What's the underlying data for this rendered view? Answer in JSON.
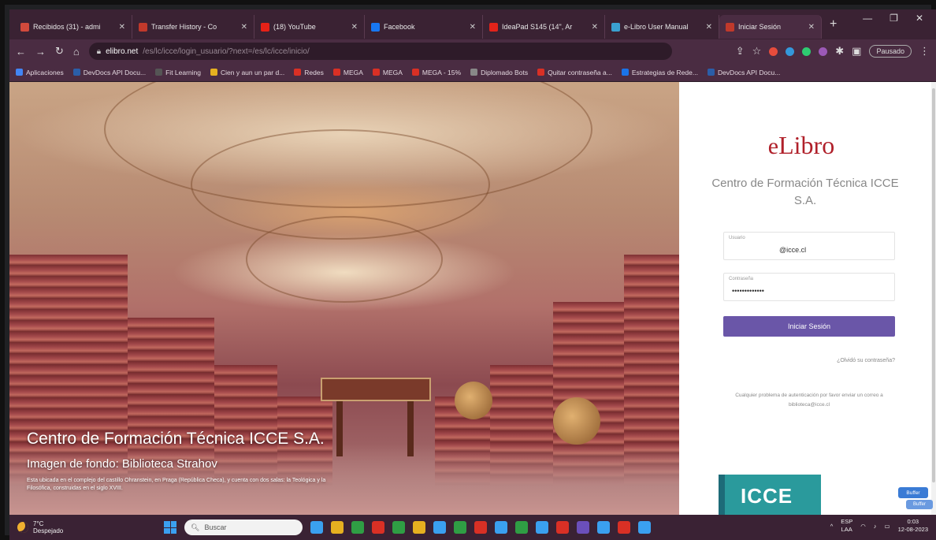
{
  "browser": {
    "tabs": [
      {
        "title": "Recibidos (31) - admi",
        "color": "#d24a3c"
      },
      {
        "title": "Transfer History - Co",
        "color": "#c0392b"
      },
      {
        "title": "(18) YouTube",
        "color": "#e62117"
      },
      {
        "title": "Facebook",
        "color": "#1877f2"
      },
      {
        "title": "IdeaPad S145 (14\", Ar",
        "color": "#e2231a"
      },
      {
        "title": "e-Libro User Manual",
        "color": "#3aa0d0"
      },
      {
        "title": "Iniciar Sesión",
        "color": "#c0392b",
        "active": true
      }
    ],
    "url_host": "elibro.net",
    "url_path": "/es/lc/icce/login_usuario/?next=/es/lc/icce/inicio/",
    "profile_label": "Pausado",
    "bookmarks": [
      {
        "label": "Aplicaciones",
        "color": "#4285f4"
      },
      {
        "label": "DevDocs API Docu...",
        "color": "#2b5ea8"
      },
      {
        "label": "Fit Learning",
        "color": "#555555"
      },
      {
        "label": "Cien y aun un par d...",
        "color": "#e6b020"
      },
      {
        "label": "Redes",
        "color": "#d93025"
      },
      {
        "label": "MEGA",
        "color": "#d93025"
      },
      {
        "label": "MEGA",
        "color": "#d93025"
      },
      {
        "label": "MEGA - 15%",
        "color": "#d93025"
      },
      {
        "label": "Diplomado Bots",
        "color": "#888888"
      },
      {
        "label": "Quitar contraseña a...",
        "color": "#d93025"
      },
      {
        "label": "Estrategias de Rede...",
        "color": "#1a73e8"
      },
      {
        "label": "DevDocs API Docu...",
        "color": "#2b5ea8"
      }
    ]
  },
  "hero": {
    "title": "Centro de Formación Técnica ICCE S.A.",
    "subtitle": "Imagen de fondo: Biblioteca Strahov",
    "description": "Esta ubicada en el complejo del castillo Ohranstein, en Praga (República Checa), y cuenta con dos salas: la Teológica y la Filosófica, construidas en el siglo XVIII."
  },
  "login": {
    "logo_e": "e",
    "logo_text": "Libro",
    "institution": "Centro de Formación Técnica ICCE S.A.",
    "username_label": "Usuario",
    "username_value": "@icce.cl",
    "password_label": "Contraseña",
    "password_value": "•••••••••••••",
    "submit_label": "Iniciar Sesión",
    "forgot_label": "¿Olvidó su contraseña?",
    "help_text": "Cualquier problema de autenticación por favor enviar un correo a biblioteca@icce.cl",
    "brand": "ICCE"
  },
  "widgets": {
    "primary": "Buffer",
    "secondary": "Buffer"
  },
  "taskbar": {
    "temperature": "7°C",
    "weather": "Despejado",
    "search_placeholder": "Buscar",
    "language": "ESP",
    "region": "LAA",
    "time": "0:03",
    "date": "12-08-2023",
    "app_colors": [
      "#3aa0f0",
      "#e6b020",
      "#2f9e44",
      "#d93025",
      "#2f9e44",
      "#e6b020",
      "#3aa0f0",
      "#2f9e44",
      "#d93025",
      "#3aa0f0",
      "#2f9e44",
      "#3aa0f0",
      "#d93025",
      "#6b4fbb",
      "#3aa0f0",
      "#d93025",
      "#3aa0f0"
    ]
  }
}
